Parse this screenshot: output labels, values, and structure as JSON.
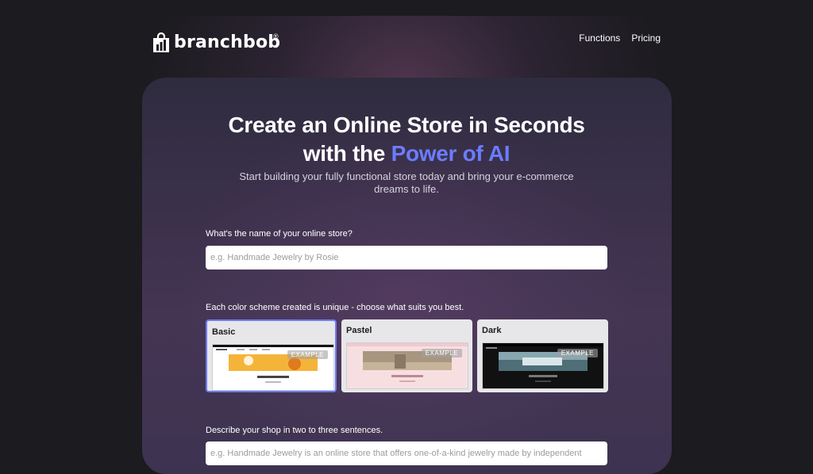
{
  "brand": {
    "name": "branchbob",
    "registered": "®"
  },
  "nav": {
    "functions": "Functions",
    "pricing": "Pricing"
  },
  "hero": {
    "title_line1": "Create an Online Store in Seconds",
    "title_line2_prefix": "with the ",
    "title_line2_accent": "Power of AI",
    "subtitle": "Start building your fully functional store today and bring your e-commerce dreams to life."
  },
  "store_name": {
    "label": "What's the name of your online store?",
    "placeholder": "e.g. Handmade Jewelry by Rosie",
    "value": ""
  },
  "color_scheme": {
    "label": "Each color scheme created is unique - choose what suits you best.",
    "options": [
      {
        "name": "Basic",
        "badge": "EXAMPLE",
        "selected": true
      },
      {
        "name": "Pastel",
        "badge": "EXAMPLE",
        "selected": false
      },
      {
        "name": "Dark",
        "badge": "EXAMPLE",
        "selected": false
      }
    ]
  },
  "description": {
    "label": "Describe your shop in two to three sentences.",
    "placeholder": "e.g. Handmade Jewelry is an online store that offers one-of-a-kind jewelry made by independent",
    "value": ""
  },
  "colors": {
    "accent": "#6b7cff",
    "background": "#1c1b1f"
  }
}
